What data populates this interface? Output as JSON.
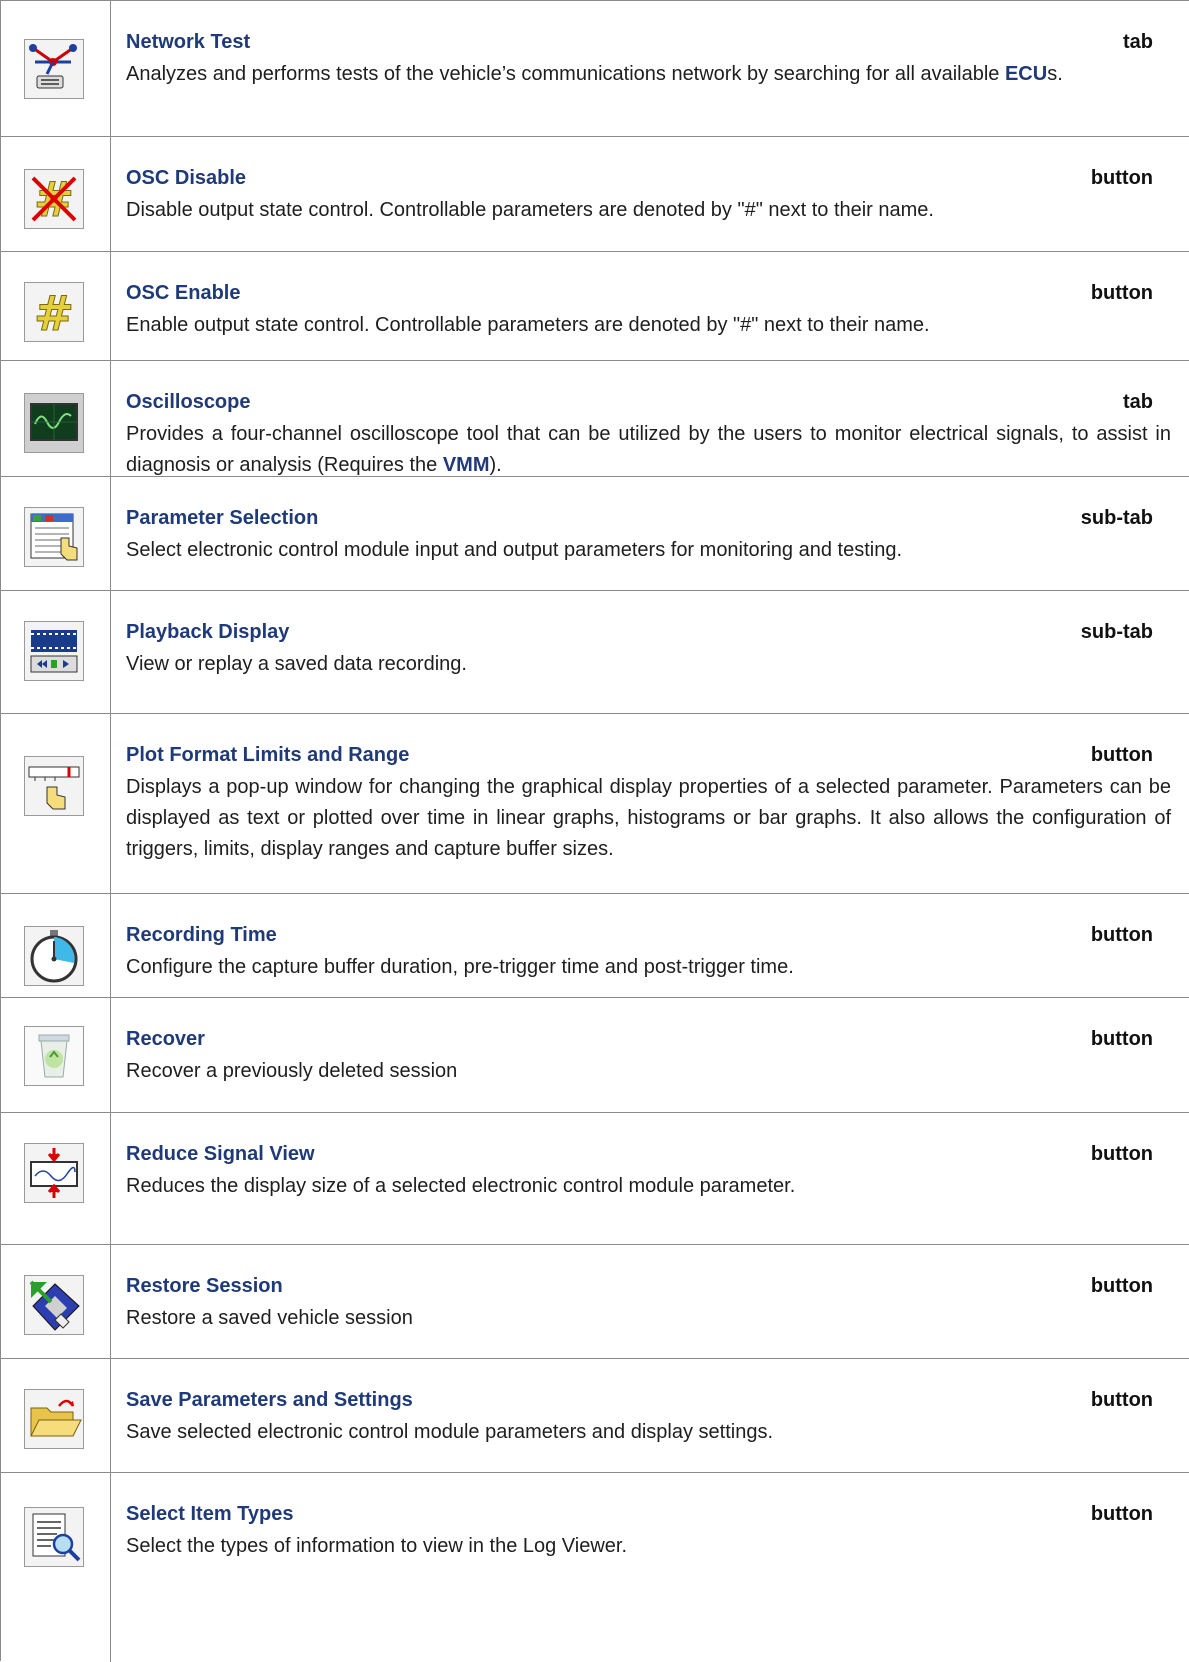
{
  "entries": [
    {
      "icon": "network-test-icon",
      "term": "Network Test",
      "kind": "tab",
      "desc": [
        {
          "t": "Analyzes and performs tests of the vehicle’s communications network by searching for all available "
        },
        {
          "t": "ECU",
          "hl": true
        },
        {
          "t": "s."
        }
      ]
    },
    {
      "icon": "osc-disable-icon",
      "term": "OSC Disable",
      "kind": "button",
      "desc": [
        {
          "t": "Disable output state control. Controllable parameters are denoted by \"#\" next to their name."
        }
      ]
    },
    {
      "icon": "osc-enable-icon",
      "term": "OSC Enable",
      "kind": "button",
      "desc": [
        {
          "t": "Enable output state control. Controllable parameters are denoted by \"#\" next to their name."
        }
      ]
    },
    {
      "icon": "oscilloscope-icon",
      "term": "Oscilloscope",
      "kind": "tab",
      "desc": [
        {
          "t": "Provides a four-channel oscilloscope tool that can be utilized by the users to monitor electrical signals, to assist in diagnosis or analysis (Requires the "
        },
        {
          "t": "VMM",
          "hl": true
        },
        {
          "t": ")."
        }
      ]
    },
    {
      "icon": "parameter-selection-icon",
      "term": "Parameter Selection",
      "kind": "sub-tab",
      "desc": [
        {
          "t": "Select electronic control module input and output parameters for monitoring and testing."
        }
      ]
    },
    {
      "icon": "playback-display-icon",
      "term": "Playback Display",
      "kind": "sub-tab",
      "desc": [
        {
          "t": "View or replay a saved data recording."
        }
      ]
    },
    {
      "icon": "plot-format-icon",
      "term": "Plot Format Limits and Range",
      "kind": "button",
      "desc": [
        {
          "t": "Displays a pop-up window for changing the graphical display properties of a selected parameter. Parameters can be displayed as text or plotted over time in linear graphs, histograms or bar graphs.  It also allows the configuration of triggers, limits, display ranges and capture buffer sizes."
        }
      ]
    },
    {
      "icon": "stopwatch-icon",
      "term": "Recording Time",
      "kind": "button",
      "desc": [
        {
          "t": "Configure the capture buffer duration, pre-trigger time and post-trigger time."
        }
      ]
    },
    {
      "icon": "recycle-bin-icon",
      "term": "Recover",
      "kind": "button",
      "desc": [
        {
          "t": "Recover a previously deleted session"
        }
      ]
    },
    {
      "icon": "reduce-signal-icon",
      "term": "Reduce Signal View",
      "kind": "button",
      "desc": [
        {
          "t": "Reduces the display size of a selected electronic control module parameter."
        }
      ]
    },
    {
      "icon": "restore-session-icon",
      "term": "Restore Session",
      "kind": "button",
      "desc": [
        {
          "t": "Restore a saved vehicle session"
        }
      ]
    },
    {
      "icon": "open-folder-icon",
      "term": "Save Parameters and Settings",
      "kind": "button",
      "desc": [
        {
          "t": "Save selected electronic control module parameters and display settings."
        }
      ]
    },
    {
      "icon": "select-item-types-icon",
      "term": "Select Item Types",
      "kind": "button",
      "desc": [
        {
          "t": "Select the types of information to view in the Log Viewer."
        }
      ]
    }
  ]
}
